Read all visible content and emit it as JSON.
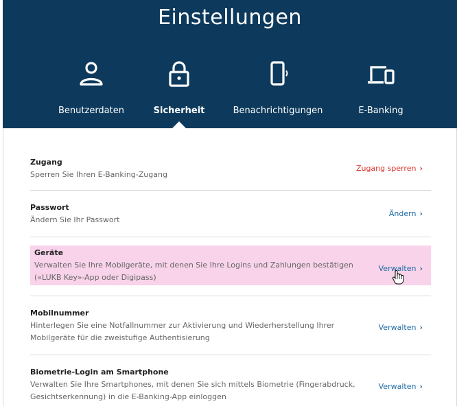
{
  "header": {
    "title": "Einstellungen",
    "tabs": [
      {
        "label": "Benutzerdaten",
        "icon": "user-icon",
        "active": false
      },
      {
        "label": "Sicherheit",
        "icon": "lock-icon",
        "active": true
      },
      {
        "label": "Benachrichtigungen",
        "icon": "phone-notification-icon",
        "active": false
      },
      {
        "label": "E-Banking",
        "icon": "laptop-phone-icon",
        "active": false
      }
    ]
  },
  "settings": [
    {
      "title": "Zugang",
      "desc": "Sperren Sie Ihren E-Banking-Zugang",
      "action": "Zugang sperren",
      "action_color": "#d8332a"
    },
    {
      "title": "Passwort",
      "desc": "Ändern Sie Ihr Passwort",
      "action": "Ändern",
      "action_color": "#1d6aa6"
    },
    {
      "title": "Geräte",
      "desc": "Verwalten Sie Ihre Mobilgeräte, mit denen Sie Ihre Logins und Zahlungen bestätigen («LUKB Key»-App oder Digipass)",
      "action": "Verwalten",
      "action_color": "#1d6aa6",
      "highlighted": true
    },
    {
      "title": "Mobilnummer",
      "desc": "Hinterlegen Sie eine Notfallnummer zur Aktivierung und Wiederherstellung Ihrer Mobilgeräte für die zweistufige Authentisierung",
      "action": "Verwalten",
      "action_color": "#1d6aa6"
    },
    {
      "title": "Biometrie-Login am Smartphone",
      "desc": "Verwalten Sie Ihre Smartphones, mit denen Sie sich mittels Biometrie (Fingerabdruck, Gesichtserkennung) in die E-Banking-App einloggen",
      "action": "Verwalten",
      "action_color": "#1d6aa6"
    }
  ],
  "colors": {
    "header_bg": "#0d3a5c",
    "link": "#1d6aa6",
    "danger": "#d8332a",
    "highlight": "#f8d3ea"
  },
  "chevron": "›"
}
